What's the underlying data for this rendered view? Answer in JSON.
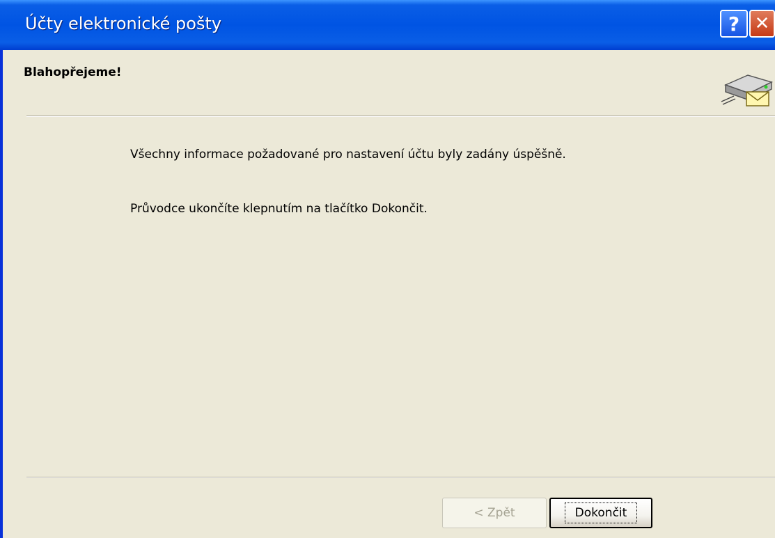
{
  "window": {
    "title": "Účty elektronické pošty",
    "help_label": "?",
    "close_label": "✕"
  },
  "header": {
    "heading": "Blahopřejeme!",
    "icon": "mail-server-icon"
  },
  "content": {
    "line1": "Všechny informace požadované pro nastavení účtu byly zadány úspěšně.",
    "line2": "Průvodce ukončíte klepnutím na tlačítko Dokončit."
  },
  "buttons": {
    "back_label": "< Zpět",
    "finish_label": "Dokončit"
  },
  "colors": {
    "titlebar": "#0054e3",
    "dialog_bg": "#ece9d8",
    "close_button": "#c53a16"
  }
}
